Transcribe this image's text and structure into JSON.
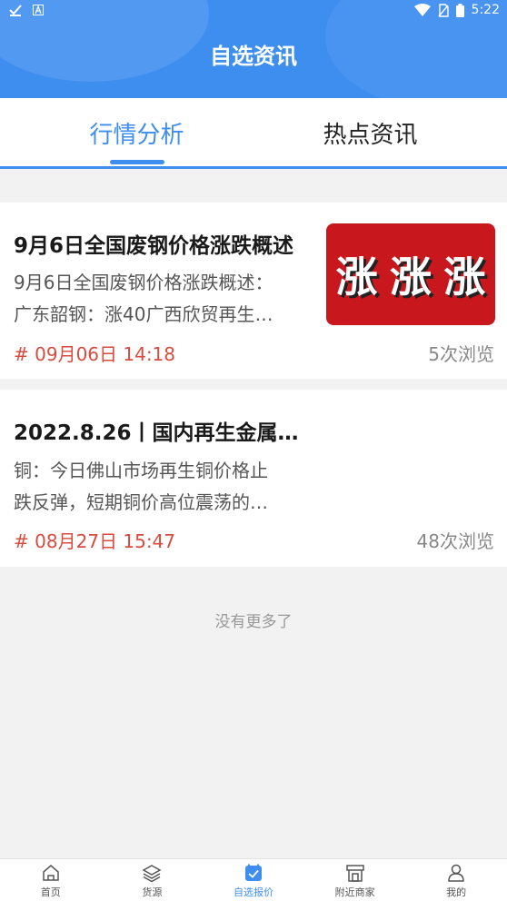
{
  "status_bar": {
    "time": "5:22"
  },
  "header": {
    "title": "自选资讯"
  },
  "tabs": [
    {
      "label": "行情分析",
      "active": true
    },
    {
      "label": "热点资讯",
      "active": false
    }
  ],
  "articles": [
    {
      "title": "9月6日全国废钢价格涨跌概述",
      "summary_line1": "9月6日全国废钢价格涨跌概述：",
      "summary_line2": "广东韶钢：涨40广西欣贸再生…",
      "date": "# 09月06日 14:18",
      "views": "5次浏览",
      "thumb_chars": [
        "涨",
        "涨",
        "涨"
      ]
    },
    {
      "title": "2022.8.26丨国内再生金属…",
      "summary_line1": "铜：今日佛山市场再生铜价格止",
      "summary_line2": "跌反弹，短期铜价高位震荡的…",
      "date": "# 08月27日 15:47",
      "views": "48次浏览"
    }
  ],
  "list_footer": "没有更多了",
  "tabbar": [
    {
      "label": "首页",
      "icon": "home-icon",
      "active": false
    },
    {
      "label": "货源",
      "icon": "layers-icon",
      "active": false
    },
    {
      "label": "自选报价",
      "icon": "checklist-icon",
      "active": true
    },
    {
      "label": "附近商家",
      "icon": "store-icon",
      "active": false
    },
    {
      "label": "我的",
      "icon": "user-icon",
      "active": false
    }
  ],
  "colors": {
    "primary": "#3e8ef0",
    "date_red": "#d94a3f",
    "thumb_red": "#c9181d"
  }
}
